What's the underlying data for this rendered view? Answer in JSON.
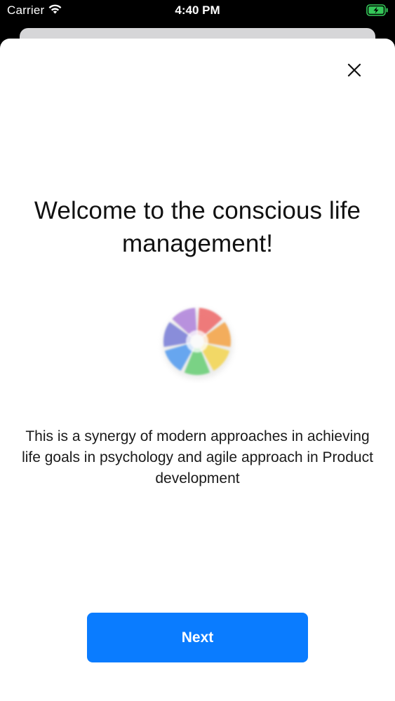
{
  "status_bar": {
    "carrier": "Carrier",
    "time": "4:40 PM",
    "battery_color": "#35c759"
  },
  "sheet": {
    "close_icon": "close-icon",
    "title": "Welcome to the conscious life management!",
    "logo_icon": "color-wheel-logo-icon",
    "description": "This is a synergy of modern approaches in achieving life goals in psychology and agile approach in Product development",
    "next_label": "Next",
    "accent_color": "#0a7cff"
  }
}
